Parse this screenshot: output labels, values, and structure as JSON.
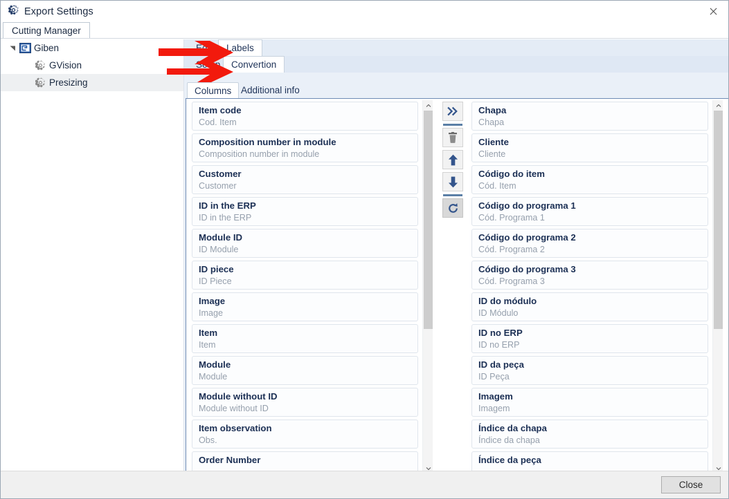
{
  "window": {
    "title": "Export Settings",
    "title_icon": "gear-icon",
    "close_icon": "close-icon"
  },
  "outer_tabs": [
    {
      "label": "Cutting Manager",
      "active": true
    }
  ],
  "tree": [
    {
      "label": "Giben",
      "level": 0,
      "icon": "giben-logo-icon",
      "expanded": true,
      "selected": false
    },
    {
      "label": "GVision",
      "level": 1,
      "icon": "gear-icon",
      "expanded": false,
      "selected": false
    },
    {
      "label": "Presizing",
      "level": 1,
      "icon": "gear-icon",
      "expanded": false,
      "selected": true
    }
  ],
  "tab_group_1": {
    "tabs": [
      {
        "label": "Edit",
        "active": false,
        "occluded": true
      },
      {
        "label": "Labels",
        "active": true,
        "occluded": false
      }
    ]
  },
  "tab_group_2": {
    "tabs": [
      {
        "label": "Setup",
        "active": false,
        "occluded": true
      },
      {
        "label": "Convertion",
        "active": true,
        "occluded": false
      }
    ]
  },
  "tab_group_3": {
    "tabs": [
      {
        "label": "Columns",
        "active": true
      },
      {
        "label": "Additional info",
        "active": false
      }
    ]
  },
  "transfer": {
    "buttons": [
      {
        "name": "move-right-button",
        "icon": "double-chevron-right-icon",
        "pressed": false
      },
      {
        "name": "delete-button",
        "icon": "trash-icon",
        "pressed": false
      },
      {
        "name": "move-up-button",
        "icon": "arrow-up-icon",
        "pressed": false
      },
      {
        "name": "move-down-button",
        "icon": "arrow-down-icon",
        "pressed": false
      },
      {
        "name": "refresh-button",
        "icon": "refresh-icon",
        "pressed": true
      }
    ],
    "available_columns": [
      {
        "title": "Item code",
        "subtitle": "Cod. Item"
      },
      {
        "title": "Composition number in module",
        "subtitle": "Composition number in module"
      },
      {
        "title": "Customer",
        "subtitle": "Customer"
      },
      {
        "title": "ID in the ERP",
        "subtitle": "ID in the ERP"
      },
      {
        "title": "Module ID",
        "subtitle": "ID Module"
      },
      {
        "title": "ID piece",
        "subtitle": "ID Piece"
      },
      {
        "title": "Image",
        "subtitle": "Image"
      },
      {
        "title": "Item",
        "subtitle": "Item"
      },
      {
        "title": "Module",
        "subtitle": "Module"
      },
      {
        "title": "Module without ID",
        "subtitle": "Module without ID"
      },
      {
        "title": "Item observation",
        "subtitle": "Obs."
      },
      {
        "title": "Order Number",
        "subtitle": ""
      }
    ],
    "selected_columns": [
      {
        "title": "Chapa",
        "subtitle": "Chapa"
      },
      {
        "title": "Cliente",
        "subtitle": "Cliente"
      },
      {
        "title": "Código do item",
        "subtitle": "Cód. Item"
      },
      {
        "title": "Código do programa 1",
        "subtitle": "Cód. Programa 1"
      },
      {
        "title": "Código do programa 2",
        "subtitle": "Cód. Programa 2"
      },
      {
        "title": "Código do programa 3",
        "subtitle": "Cód. Programa 3"
      },
      {
        "title": "ID do módulo",
        "subtitle": "ID Módulo"
      },
      {
        "title": "ID no ERP",
        "subtitle": "ID no ERP"
      },
      {
        "title": "ID da peça",
        "subtitle": "ID Peça"
      },
      {
        "title": "Imagem",
        "subtitle": "Imagem"
      },
      {
        "title": "Índice da chapa",
        "subtitle": "Índice da chapa"
      },
      {
        "title": "Índice da peça",
        "subtitle": ""
      }
    ],
    "left_scrollbar": {
      "thumb_top_pct": 0,
      "thumb_height_pct": 62
    },
    "right_scrollbar": {
      "thumb_top_pct": 0,
      "thumb_height_pct": 62
    }
  },
  "footer": {
    "close_label": "Close"
  },
  "annotations": [
    {
      "name": "arrow-to-labels-tab",
      "target": "Labels"
    },
    {
      "name": "arrow-to-convertion-tab",
      "target": "Convertion"
    }
  ],
  "colors": {
    "accent": "#21355a",
    "panel_blue": "#eaf0f8",
    "tab_blue": "#dfe8f4",
    "annotation_red": "#f21a0d",
    "item_title": "#1b2f54",
    "item_subtitle": "#96a0ad",
    "selection_gray": "#eef0f2"
  }
}
